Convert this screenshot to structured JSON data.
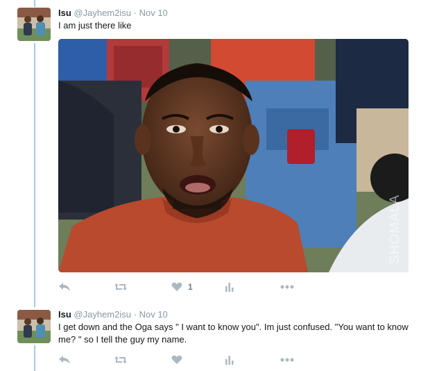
{
  "tweets": [
    {
      "name": "Isu",
      "handle": "@Jayhem2isu",
      "separator": "·",
      "date": "Nov 10",
      "text": "I am just there like",
      "media_watermark": "SHOMALA",
      "actions": {
        "like_count": "1"
      },
      "icons": [
        "reply-icon",
        "retweet-icon",
        "heart-icon",
        "analytics-icon",
        "more-icon"
      ]
    },
    {
      "name": "Isu",
      "handle": "@Jayhem2isu",
      "separator": "·",
      "date": "Nov 10",
      "text": "I get down and the Oga says \" I want to know you\". Im just confused. \"You want to know me? \" so I tell the guy my name.",
      "actions": {
        "like_count": ""
      },
      "icons": [
        "reply-icon",
        "retweet-icon",
        "heart-icon",
        "analytics-icon",
        "more-icon"
      ]
    }
  ],
  "colors": {
    "thread_line": "#a8c8e6",
    "secondary_text": "#8899a6",
    "icon": "#aab8c2"
  }
}
